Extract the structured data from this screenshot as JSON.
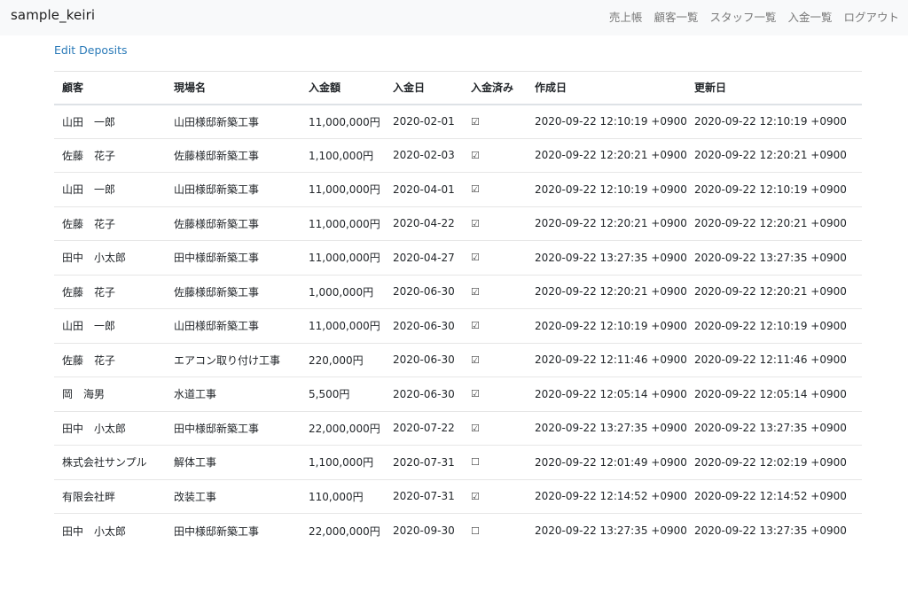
{
  "navbar": {
    "brand": "sample_keiri",
    "links": [
      "売上帳",
      "顧客一覧",
      "スタッフ一覧",
      "入金一覧",
      "ログアウト"
    ]
  },
  "page": {
    "edit_link": "Edit Deposits"
  },
  "table": {
    "headers": [
      "顧客",
      "現場名",
      "入金額",
      "入金日",
      "入金済み",
      "作成日",
      "更新日"
    ],
    "rows": [
      [
        "山田　一郎",
        "山田様邸新築工事",
        "11,000,000円",
        "2020-02-01",
        "☑",
        "2020-09-22 12:10:19 +0900",
        "2020-09-22 12:10:19 +0900"
      ],
      [
        "佐藤　花子",
        "佐藤様邸新築工事",
        "1,100,000円",
        "2020-02-03",
        "☑",
        "2020-09-22 12:20:21 +0900",
        "2020-09-22 12:20:21 +0900"
      ],
      [
        "山田　一郎",
        "山田様邸新築工事",
        "11,000,000円",
        "2020-04-01",
        "☑",
        "2020-09-22 12:10:19 +0900",
        "2020-09-22 12:10:19 +0900"
      ],
      [
        "佐藤　花子",
        "佐藤様邸新築工事",
        "11,000,000円",
        "2020-04-22",
        "☑",
        "2020-09-22 12:20:21 +0900",
        "2020-09-22 12:20:21 +0900"
      ],
      [
        "田中　小太郎",
        "田中様邸新築工事",
        "11,000,000円",
        "2020-04-27",
        "☑",
        "2020-09-22 13:27:35 +0900",
        "2020-09-22 13:27:35 +0900"
      ],
      [
        "佐藤　花子",
        "佐藤様邸新築工事",
        "1,000,000円",
        "2020-06-30",
        "☑",
        "2020-09-22 12:20:21 +0900",
        "2020-09-22 12:20:21 +0900"
      ],
      [
        "山田　一郎",
        "山田様邸新築工事",
        "11,000,000円",
        "2020-06-30",
        "☑",
        "2020-09-22 12:10:19 +0900",
        "2020-09-22 12:10:19 +0900"
      ],
      [
        "佐藤　花子",
        "エアコン取り付け工事",
        "220,000円",
        "2020-06-30",
        "☑",
        "2020-09-22 12:11:46 +0900",
        "2020-09-22 12:11:46 +0900"
      ],
      [
        "岡　海男",
        "水道工事",
        "5,500円",
        "2020-06-30",
        "☑",
        "2020-09-22 12:05:14 +0900",
        "2020-09-22 12:05:14 +0900"
      ],
      [
        "田中　小太郎",
        "田中様邸新築工事",
        "22,000,000円",
        "2020-07-22",
        "☑",
        "2020-09-22 13:27:35 +0900",
        "2020-09-22 13:27:35 +0900"
      ],
      [
        "株式会社サンプル",
        "解体工事",
        "1,100,000円",
        "2020-07-31",
        "☐",
        "2020-09-22 12:01:49 +0900",
        "2020-09-22 12:02:19 +0900"
      ],
      [
        "有限会社畔",
        "改装工事",
        "110,000円",
        "2020-07-31",
        "☑",
        "2020-09-22 12:14:52 +0900",
        "2020-09-22 12:14:52 +0900"
      ],
      [
        "田中　小太郎",
        "田中様邸新築工事",
        "22,000,000円",
        "2020-09-30",
        "☐",
        "2020-09-22 13:27:35 +0900",
        "2020-09-22 13:27:35 +0900"
      ]
    ]
  },
  "colors": {
    "navbar_bg": "#f8f9fa",
    "link": "#2a7ab8",
    "nav_link": "#7a7a7a"
  }
}
